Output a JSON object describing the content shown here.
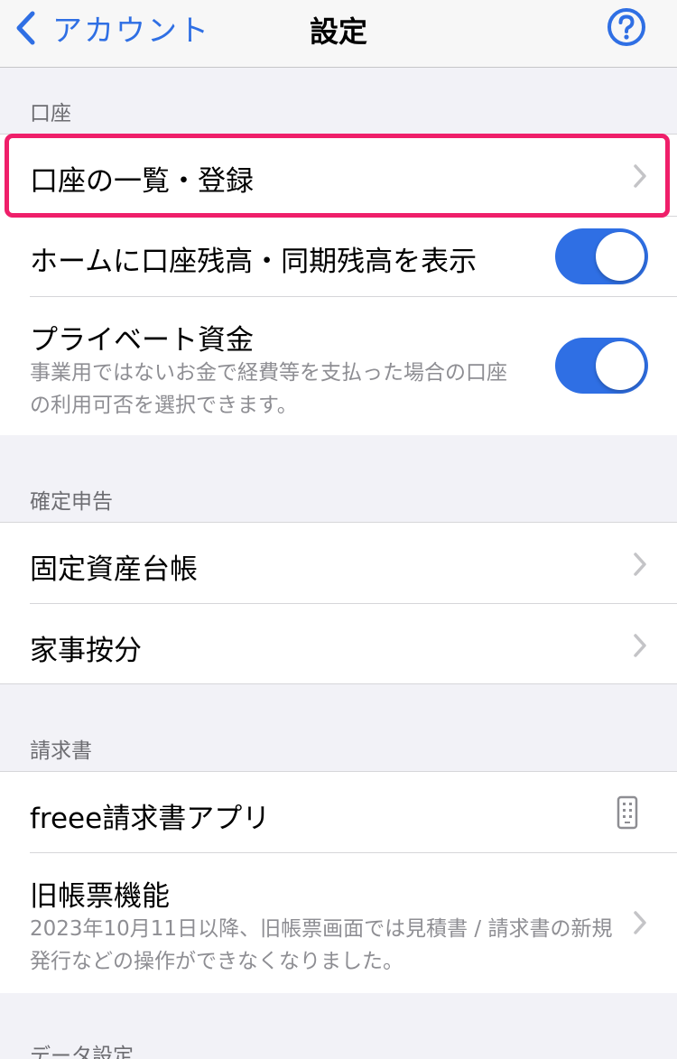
{
  "navbar": {
    "back_label": "アカウント",
    "title": "設定"
  },
  "sections": {
    "account": {
      "header": "口座",
      "items": [
        {
          "label": "口座の一覧・登録"
        },
        {
          "label": "ホームに口座残高・同期残高を表示",
          "toggle": "on"
        },
        {
          "label": "プライベート資金",
          "sub": "事業用ではないお金で経費等を支払った場合の口座の利用可否を選択できます。",
          "toggle": "on"
        }
      ]
    },
    "tax": {
      "header": "確定申告",
      "items": [
        {
          "label": "固定資産台帳"
        },
        {
          "label": "家事按分"
        }
      ]
    },
    "invoice": {
      "header": "請求書",
      "items": [
        {
          "label": "freee請求書アプリ"
        },
        {
          "label": "旧帳票機能",
          "sub": "2023年10月11日以降、旧帳票画面では見積書 / 請求書の新規発行などの操作ができなくなりました。"
        }
      ]
    },
    "data": {
      "header": "データ設定"
    }
  },
  "colors": {
    "accent": "#2f6fe4",
    "highlight": "#ef1f6a",
    "background": "#f2f2f7"
  },
  "icons": {
    "back": "chevron-left-icon",
    "help": "question-circle-icon",
    "disclosure": "chevron-right-icon",
    "external_app": "smartphone-icon"
  }
}
